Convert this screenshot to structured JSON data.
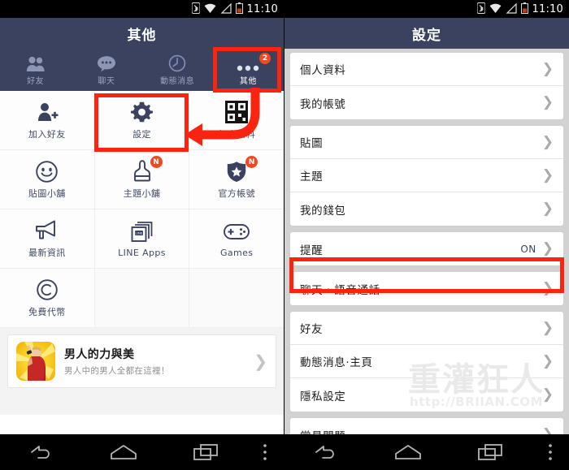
{
  "statusbar": {
    "time": "11:10",
    "icons": [
      "bluetooth-icon",
      "wifi-icon",
      "signal-icon",
      "battery-icon"
    ]
  },
  "left_screen": {
    "header": {
      "title": "其他"
    },
    "tabs": [
      {
        "label": "好友",
        "icon": "friends-icon",
        "active": false,
        "badge": ""
      },
      {
        "label": "聊天",
        "icon": "chat-icon",
        "active": false,
        "badge": ""
      },
      {
        "label": "動態消息",
        "icon": "timeline-icon",
        "active": false,
        "badge": ""
      },
      {
        "label": "其他",
        "icon": "more-icon",
        "active": true,
        "badge": "2"
      }
    ],
    "grid": [
      [
        {
          "label": "加入好友",
          "icon": "add-friend-icon",
          "badge": ""
        },
        {
          "label": "設定",
          "icon": "gear-icon",
          "badge": ""
        },
        {
          "label": "個人資料",
          "icon": "qr-profile-icon",
          "badge": ""
        }
      ],
      [
        {
          "label": "貼圖小舖",
          "icon": "sticker-shop-icon",
          "badge": ""
        },
        {
          "label": "主題小舖",
          "icon": "theme-shop-icon",
          "badge": "N"
        },
        {
          "label": "官方帳號",
          "icon": "official-badge-icon",
          "badge": "N"
        }
      ],
      [
        {
          "label": "最新資訊",
          "icon": "megaphone-icon",
          "badge": ""
        },
        {
          "label": "LINE Apps",
          "icon": "line-apps-icon",
          "badge": ""
        },
        {
          "label": "Games",
          "icon": "gamepad-icon",
          "badge": ""
        }
      ],
      [
        {
          "label": "免費代幣",
          "icon": "free-coin-icon",
          "badge": ""
        },
        {
          "label": "",
          "icon": "",
          "badge": ""
        },
        {
          "label": "",
          "icon": "",
          "badge": ""
        }
      ]
    ],
    "promo": {
      "title": "男人的力與美",
      "subtitle": "男人中的男人全都在這裡！",
      "thumb": "muscle-man-thumbnail",
      "chevron": "chevron-right-icon"
    }
  },
  "right_screen": {
    "header": {
      "title": "設定"
    },
    "groups": [
      {
        "rows": [
          {
            "label": "個人資料",
            "value": ""
          },
          {
            "label": "我的帳號",
            "value": ""
          }
        ]
      },
      {
        "rows": [
          {
            "label": "貼圖",
            "value": ""
          },
          {
            "label": "主題",
            "value": ""
          },
          {
            "label": "我的錢包",
            "value": ""
          }
        ]
      },
      {
        "rows": [
          {
            "label": "提醒",
            "value": "ON"
          }
        ]
      },
      {
        "rows": [
          {
            "label": "聊天・語音通話",
            "value": ""
          }
        ]
      },
      {
        "rows": [
          {
            "label": "好友",
            "value": ""
          },
          {
            "label": "動態消息·主頁",
            "value": ""
          },
          {
            "label": "隱私設定",
            "value": ""
          }
        ]
      },
      {
        "rows": [
          {
            "label": "常見問題",
            "value": ""
          }
        ]
      }
    ]
  },
  "watermark": {
    "main": "重灌狂人",
    "url": "http://BRIIAN.COM"
  },
  "navbar": {
    "buttons": [
      "back-icon",
      "home-icon",
      "recents-icon",
      "menu-icon"
    ]
  },
  "annotations": {
    "highlight_color": "#fb2410",
    "targets": [
      "more-tab-highlight",
      "settings-cell-highlight",
      "chat-voicecall-row-highlight"
    ],
    "arrow": "curved-arrow-pointing-to-settings"
  },
  "colors": {
    "header_bg": "#3b4260",
    "badge_red": "#f0491e",
    "list_bg": "#d2d2d2",
    "icon_navy": "#3b4260"
  }
}
